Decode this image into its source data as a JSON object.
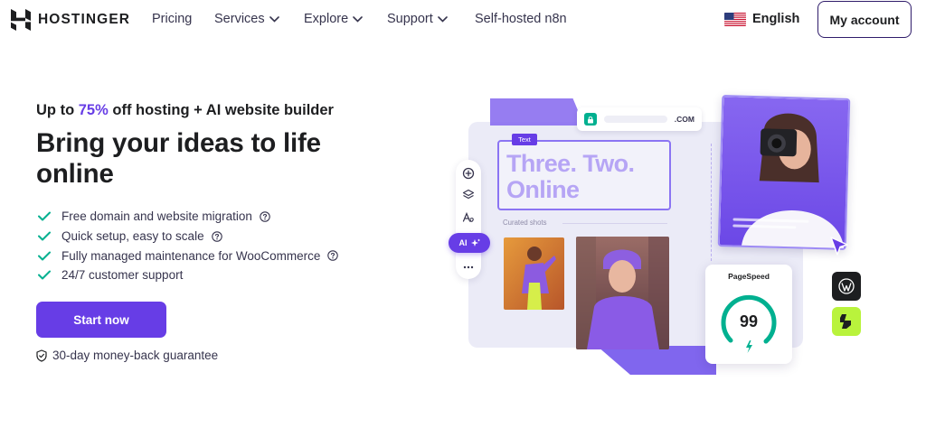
{
  "brand": {
    "name": "HOSTINGER",
    "accent_color": "#673de6",
    "success_color": "#00b090"
  },
  "nav": {
    "pricing": "Pricing",
    "services": "Services",
    "explore": "Explore",
    "support": "Support",
    "n8n": "Self-hosted n8n",
    "language": "English",
    "account": "My account"
  },
  "hero": {
    "promo_prefix": "Up to ",
    "promo_discount": "75%",
    "promo_suffix": " off hosting + AI website builder",
    "title": "Bring your ideas to life online",
    "features": [
      "Free domain and website migration",
      "Quick setup, easy to scale",
      "Fully managed maintenance for WooCommerce",
      "24/7 customer support"
    ],
    "cta": "Start now",
    "guarantee": "30-day money-back guarantee"
  },
  "illustration": {
    "url_tld": ".COM",
    "text_tag": "Text",
    "text_line1": "Three. Two.",
    "text_line2": "Online",
    "curated": "Curated shots",
    "ai_label": "AI",
    "pagespeed_label": "PageSpeed",
    "pagespeed_score": "99",
    "icons": [
      "plus-circle-icon",
      "layers-icon",
      "text-style-icon",
      "sparkle-icon",
      "more-icon",
      "lock-icon",
      "wordpress-icon",
      "litespeed-icon",
      "cursor-icon",
      "bolt-icon"
    ]
  }
}
